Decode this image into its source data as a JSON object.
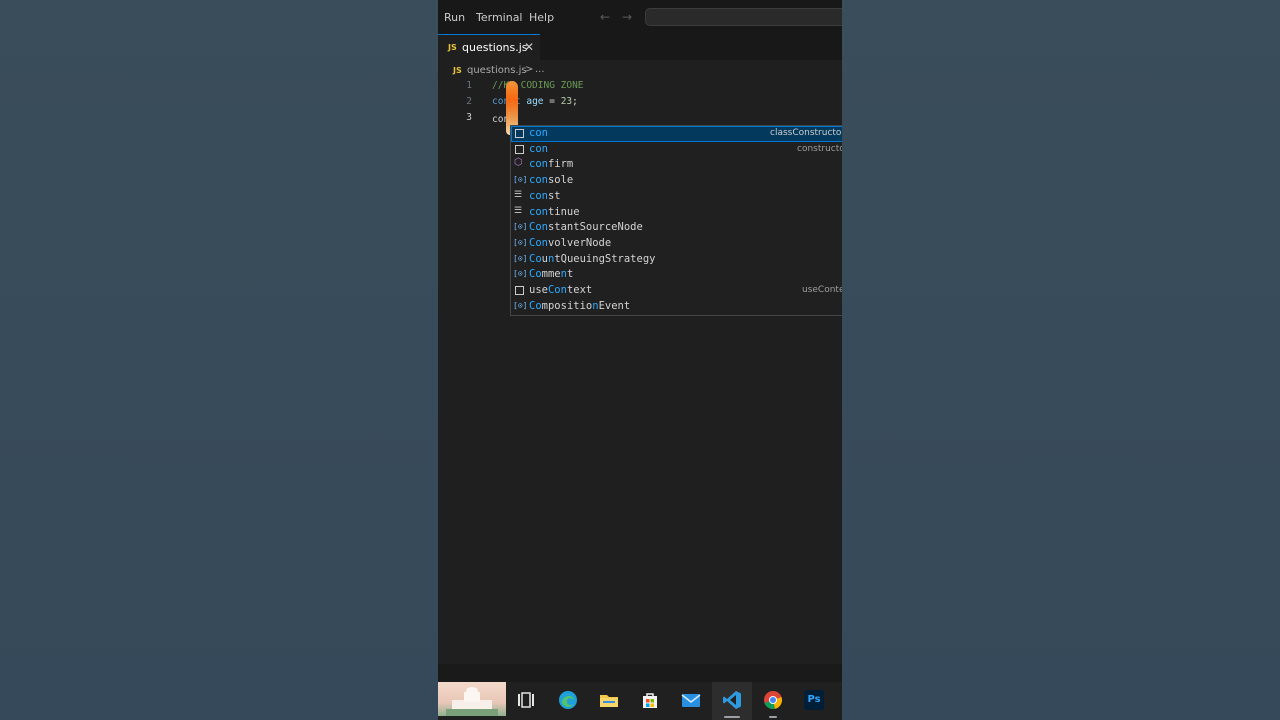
{
  "menu": {
    "items": [
      "Run",
      "Terminal",
      "Help"
    ],
    "back_arrow": "←",
    "forward_arrow": "→"
  },
  "tab": {
    "badge": "JS",
    "label": "questions.js",
    "close": "✕"
  },
  "breadcrumb": {
    "badge": "JS",
    "file": "questions.js",
    "separator": ">",
    "more": "..."
  },
  "editor": {
    "line_numbers": [
      "1",
      "2",
      "3"
    ],
    "line1": {
      "comment": "//KK CODING ZONE"
    },
    "line2": {
      "keyword": "const",
      "var": "age",
      "op": " = ",
      "num": "23",
      "end": ";"
    },
    "line3": {
      "typed": "con"
    }
  },
  "suggest": {
    "typed_prefix": "con",
    "items": [
      {
        "icon": "box",
        "pre": "",
        "hl": "con",
        "post": "",
        "detail": "classConstructor",
        "selected": true
      },
      {
        "icon": "box",
        "pre": "",
        "hl": "con",
        "post": "",
        "detail": "constructor",
        "selected": false
      },
      {
        "icon": "cube",
        "pre": "",
        "hl": "con",
        "post": "firm",
        "detail": "",
        "selected": false
      },
      {
        "icon": "var",
        "pre": "",
        "hl": "con",
        "post": "sole",
        "detail": "",
        "selected": false
      },
      {
        "icon": "snip",
        "pre": "",
        "hl": "con",
        "post": "st",
        "detail": "",
        "selected": false
      },
      {
        "icon": "snip",
        "pre": "",
        "hl": "con",
        "post": "tinue",
        "detail": "",
        "selected": false
      },
      {
        "icon": "var",
        "pre": "",
        "hl": "Con",
        "post": "stantSourceNode",
        "detail": "",
        "selected": false
      },
      {
        "icon": "var",
        "pre": "",
        "hl": "Con",
        "post": "volverNode",
        "detail": "",
        "selected": false
      },
      {
        "icon": "var",
        "pre": "",
        "hl": "Co",
        "post": "u",
        "hl2": "n",
        "post2": "tQueuingStrategy",
        "detail": "",
        "selected": false
      },
      {
        "icon": "var",
        "pre": "",
        "hl": "Co",
        "post": "mme",
        "hl2": "n",
        "post2": "t",
        "detail": "",
        "selected": false
      },
      {
        "icon": "box",
        "pre": "use",
        "hl": "Con",
        "post": "text",
        "detail": "useContext",
        "selected": false
      },
      {
        "icon": "var",
        "pre": "",
        "hl": "Co",
        "post": "mpositio",
        "hl2": "n",
        "post2": "Event",
        "detail": "",
        "selected": false
      }
    ]
  },
  "taskbar": {
    "apps": [
      "news-widget",
      "task-view",
      "edge",
      "file-explorer",
      "microsoft-store",
      "mail",
      "vscode",
      "chrome",
      "photoshop"
    ],
    "photoshop_label": "Ps",
    "colors": {
      "edge": "#1fa0d8",
      "folder": "#f2c94c",
      "store": "#3a8ee6",
      "mail": "#2b8fe0",
      "vscode": "#2f9ae0",
      "chrome_red": "#db4437",
      "chrome_green": "#0f9d58",
      "chrome_yellow": "#f4b400",
      "ps_bg": "#001e36",
      "ps_text": "#31a8ff"
    }
  }
}
